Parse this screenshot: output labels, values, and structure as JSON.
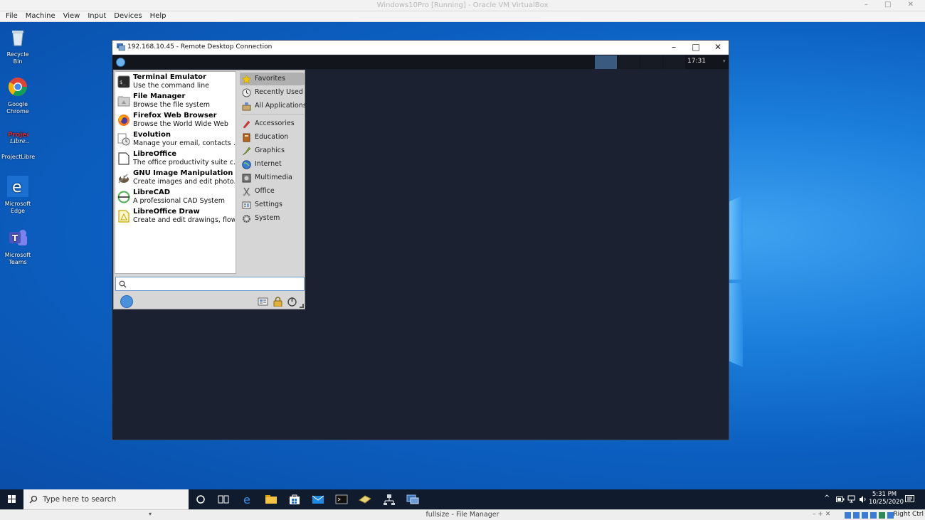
{
  "host": {
    "title": "Windows10Pro [Running] - Oracle VM VirtualBox",
    "menu": [
      "File",
      "Machine",
      "View",
      "Input",
      "Devices",
      "Help"
    ],
    "status_title": "fullsize - File Manager",
    "host_key": "Right Ctrl"
  },
  "desktop_icons": [
    {
      "label": "Recycle Bin",
      "icon": "recycle-bin-icon"
    },
    {
      "label": "Google Chrome",
      "icon": "chrome-icon"
    },
    {
      "label": "ProjectLibre",
      "icon": "projectlibre-icon"
    },
    {
      "label": "Microsoft Edge",
      "icon": "edge-icon"
    },
    {
      "label": "Microsoft Teams",
      "icon": "teams-icon"
    }
  ],
  "rdp": {
    "title": "192.168.10.45 - Remote Desktop Connection",
    "clock": "17:31"
  },
  "whisker": {
    "favorites": [
      {
        "name": "Terminal Emulator",
        "desc": "Use the command line",
        "icon": "terminal-icon"
      },
      {
        "name": "File Manager",
        "desc": "Browse the file system",
        "icon": "file-manager-icon"
      },
      {
        "name": "Firefox Web Browser",
        "desc": "Browse the World Wide Web",
        "icon": "firefox-icon"
      },
      {
        "name": "Evolution",
        "desc": "Manage your email, contacts ...",
        "icon": "evolution-icon"
      },
      {
        "name": "LibreOffice",
        "desc": "The office productivity suite c...",
        "icon": "libreoffice-icon"
      },
      {
        "name": "GNU Image Manipulation ...",
        "desc": "Create images and edit photo...",
        "icon": "gimp-icon"
      },
      {
        "name": "LibreCAD",
        "desc": "A professional CAD System",
        "icon": "librecad-icon"
      },
      {
        "name": "LibreOffice Draw",
        "desc": "Create and edit drawings, flow...",
        "icon": "libreoffice-draw-icon"
      }
    ],
    "categories": [
      {
        "label": "Favorites",
        "icon": "star-icon",
        "active": true
      },
      {
        "label": "Recently Used",
        "icon": "clock-icon"
      },
      {
        "label": "All Applications",
        "icon": "applications-icon"
      },
      {
        "label": "Accessories",
        "icon": "accessories-icon"
      },
      {
        "label": "Education",
        "icon": "education-icon"
      },
      {
        "label": "Graphics",
        "icon": "graphics-icon"
      },
      {
        "label": "Internet",
        "icon": "internet-icon"
      },
      {
        "label": "Multimedia",
        "icon": "multimedia-icon"
      },
      {
        "label": "Office",
        "icon": "office-icon"
      },
      {
        "label": "Settings",
        "icon": "settings-icon"
      },
      {
        "label": "System",
        "icon": "system-icon"
      }
    ],
    "search_value": ""
  },
  "taskbar": {
    "search_placeholder": "Type here to search",
    "time": "5:31 PM",
    "date": "10/25/2020"
  },
  "colors": {
    "desktop_blue": "#1c7fdc",
    "rdp_bg": "#1b2131",
    "panel": "#12151c",
    "taskbar": "#101b2d"
  }
}
